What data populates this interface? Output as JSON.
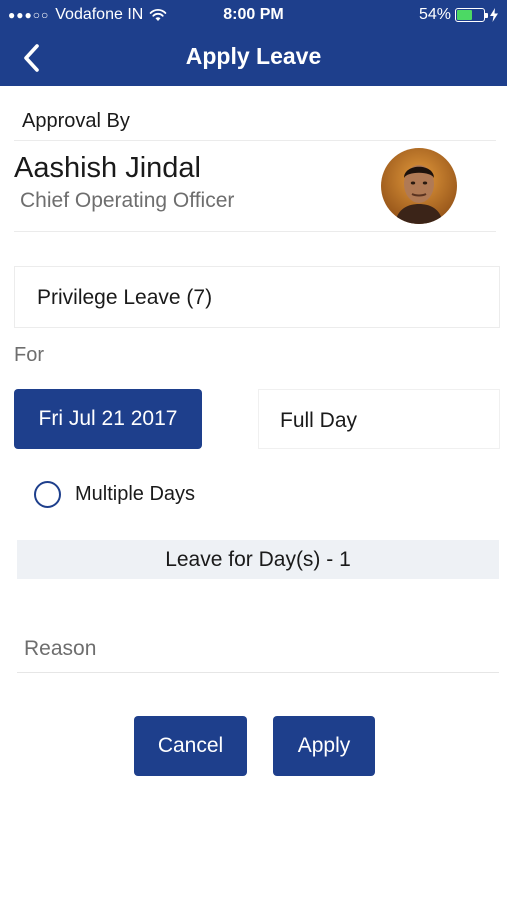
{
  "status_bar": {
    "signal": "●●●○○",
    "carrier": "Vodafone IN",
    "time": "8:00 PM",
    "battery_percent": "54%",
    "battery_level": 0.54,
    "icons": [
      "wifi-icon",
      "battery-icon",
      "charging-bolt-icon"
    ]
  },
  "nav": {
    "back_icon": "chevron-left-icon",
    "title": "Apply Leave"
  },
  "approval": {
    "label": "Approval By",
    "name": "Aashish Jindal",
    "title": "Chief Operating Officer"
  },
  "leave_type": "Privilege Leave (7)",
  "for_label": "For",
  "date": "Fri Jul 21 2017",
  "day_type": "Full Day",
  "multiple_days": {
    "label": "Multiple Days",
    "checked": false
  },
  "leave_count": "Leave for Day(s) - 1",
  "reason": {
    "placeholder": "Reason",
    "value": ""
  },
  "buttons": {
    "cancel": "Cancel",
    "apply": "Apply"
  },
  "colors": {
    "primary": "#1e3f8c",
    "background": "#ffffff",
    "muted_text": "#6e6e6e",
    "info_bar": "#eef1f5"
  }
}
